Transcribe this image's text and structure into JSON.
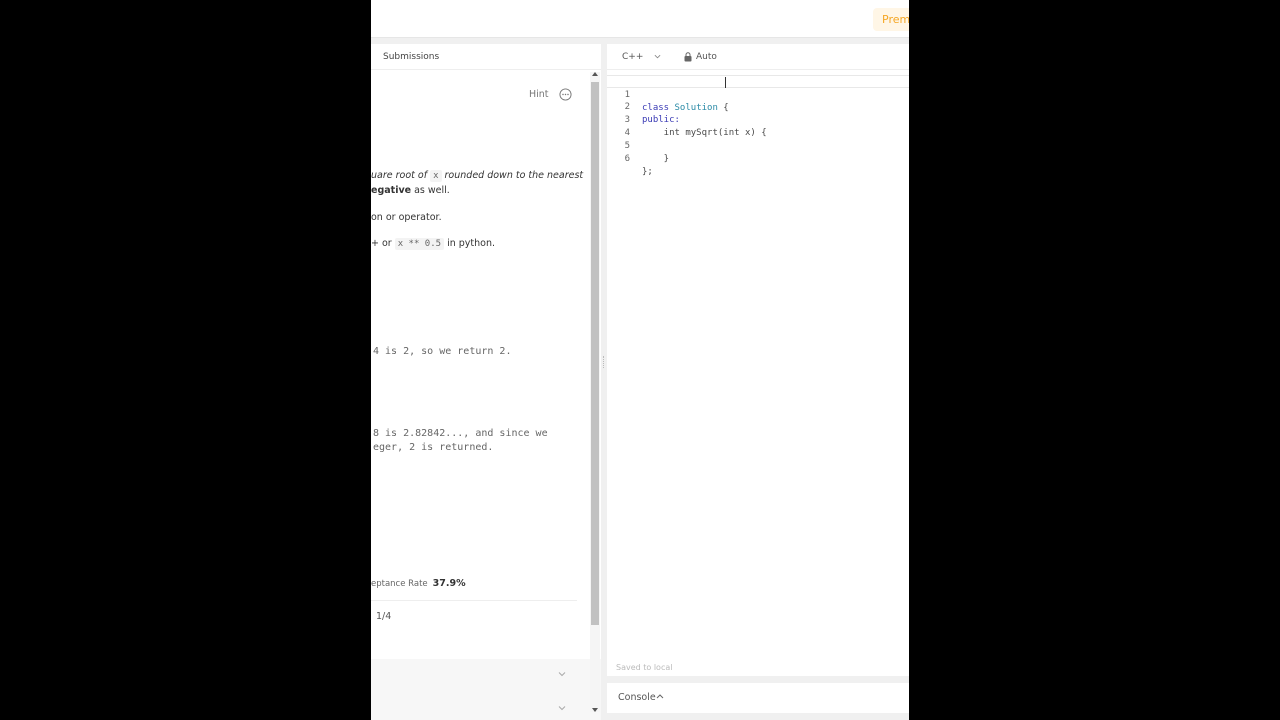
{
  "header": {
    "premium_label": "Premium"
  },
  "left_panel": {
    "tab_submissions": "Submissions",
    "hint_label": "Hint",
    "description": {
      "line1_italic": "uare root of",
      "line1_code": "x",
      "line1_rest": "rounded down to the nearest",
      "line2_bold": "egative",
      "line2_rest": " as well.",
      "line3": "on or operator.",
      "line4_prefix": "+ or ",
      "line4_code": "x ** 0.5",
      "line4_suffix": " in python."
    },
    "example1_output": "4 is 2, so we return 2.",
    "example2_output_line1": "8 is 2.82842..., and since we",
    "example2_output_line2": "eger, 2 is returned.",
    "acceptance_label": "eptance Rate",
    "acceptance_value": "37.9%",
    "pager": "1/4"
  },
  "editor": {
    "language": "C++",
    "autocomplete_label": "Auto",
    "lines": [
      {
        "num": "1"
      },
      {
        "num": "2"
      },
      {
        "num": "3"
      },
      {
        "num": "4"
      },
      {
        "num": "5"
      },
      {
        "num": "6"
      }
    ],
    "code": {
      "l1_kw": "class",
      "l1_type": "Solution",
      "l1_rest": "{",
      "l2_kw": "public:",
      "l3_text": "    int mySqrt(int x) {",
      "l4_text": "",
      "l5_text": "    }",
      "l6_text": "};"
    },
    "saved_label": "Saved to local"
  },
  "console": {
    "label": "Console"
  },
  "colors": {
    "premium_text": "#f5a623",
    "premium_bg": "#fff6e6",
    "keyword": "#3b3bb5",
    "type": "#2a8aa6"
  },
  "icons": {
    "more": "ellipsis-circle-icon",
    "lang_dropdown": "chevron-down-icon",
    "lock": "lock-icon",
    "console_toggle": "chevron-up-icon",
    "collapse": "chevron-down-icon"
  }
}
